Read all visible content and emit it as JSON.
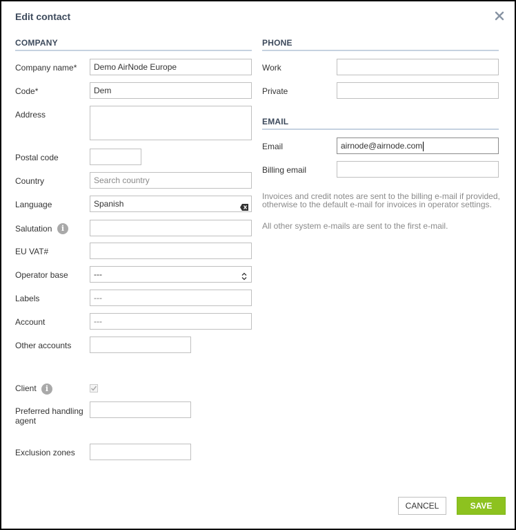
{
  "dialog": {
    "title": "Edit contact"
  },
  "company": {
    "section": "COMPANY",
    "company_name": {
      "label": "Company name*",
      "value": "Demo AirNode Europe"
    },
    "code": {
      "label": "Code*",
      "value": "Dem"
    },
    "address": {
      "label": "Address",
      "value": ""
    },
    "postal_code": {
      "label": "Postal code",
      "value": ""
    },
    "country": {
      "label": "Country",
      "placeholder": "Search country"
    },
    "language": {
      "label": "Language",
      "value": "Spanish"
    },
    "salutation": {
      "label": "Salutation",
      "value": ""
    },
    "eu_vat": {
      "label": "EU VAT#",
      "value": ""
    },
    "operator_base": {
      "label": "Operator base",
      "value": "---"
    },
    "labels": {
      "label": "Labels",
      "value": "---"
    },
    "account": {
      "label": "Account",
      "value": "---"
    },
    "other_accounts": {
      "label": "Other accounts",
      "value": ""
    },
    "client": {
      "label": "Client",
      "checked": true
    },
    "preferred_handling_agent": {
      "label": "Preferred handling agent",
      "value": ""
    },
    "exclusion_zones": {
      "label": "Exclusion zones",
      "value": ""
    }
  },
  "phone": {
    "section": "PHONE",
    "work": {
      "label": "Work",
      "value": ""
    },
    "private": {
      "label": "Private",
      "value": ""
    }
  },
  "email": {
    "section": "EMAIL",
    "email": {
      "label": "Email",
      "value": "airnode@airnode.com"
    },
    "billing_email": {
      "label": "Billing email",
      "value": ""
    },
    "note_billing": "Invoices and credit notes are sent to the billing e-mail if provided, otherwise to the default e-mail for invoices in operator settings.",
    "note_system": "All other system e-mails are sent to the first e-mail."
  },
  "buttons": {
    "cancel": "CANCEL",
    "save": "SAVE"
  },
  "colors": {
    "heading": "#3d4a5c",
    "accent_save": "#8dc21f",
    "rule": "#c5d2e0"
  },
  "icons": {
    "close": "close-icon",
    "info": "info-icon",
    "clear": "clear-input-icon",
    "select": "chevron-updown-icon"
  }
}
